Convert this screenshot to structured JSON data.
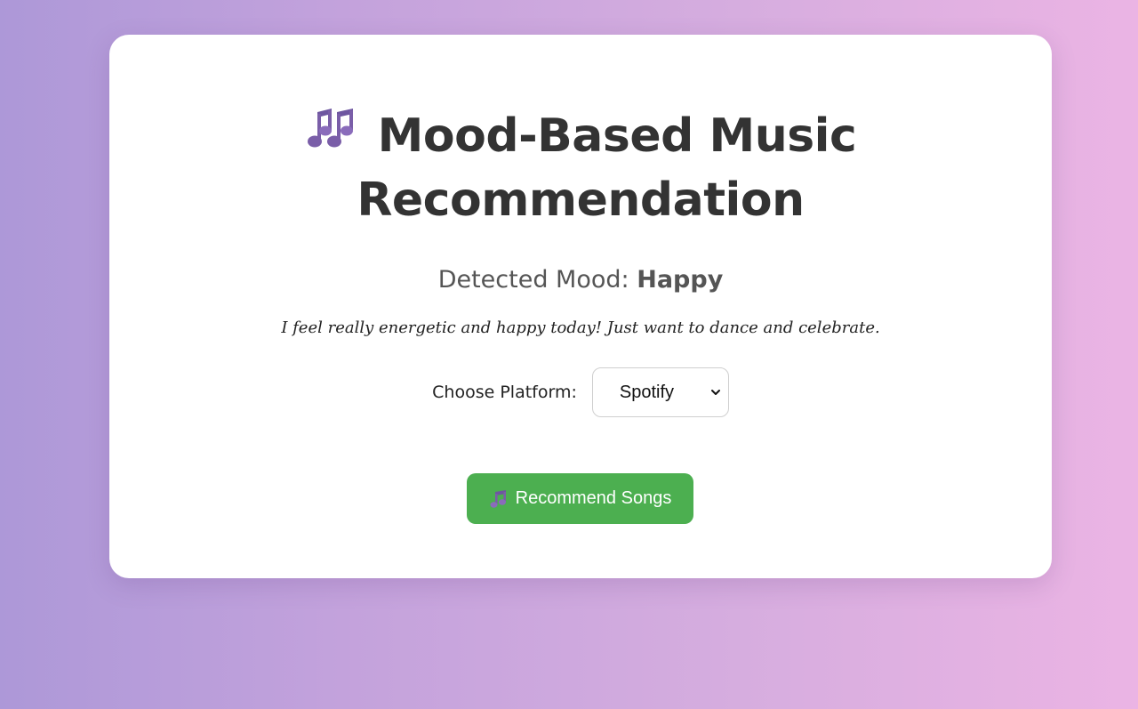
{
  "header": {
    "icon": "musical-notes-icon",
    "title_line1": "Mood-Based Music",
    "title_line2": "Recommendation"
  },
  "mood": {
    "label": "Detected Mood:",
    "value": "Happy"
  },
  "input_text": "I feel really energetic and happy today! Just want to dance and celebrate.",
  "platform": {
    "label": "Choose Platform:",
    "selected": "Spotify"
  },
  "actions": {
    "recommend_icon": "musical-note-icon",
    "recommend_label": "Recommend Songs"
  },
  "colors": {
    "button_bg": "#4caf50",
    "icon_purple": "#7a5ea8",
    "title_text": "#333333"
  }
}
